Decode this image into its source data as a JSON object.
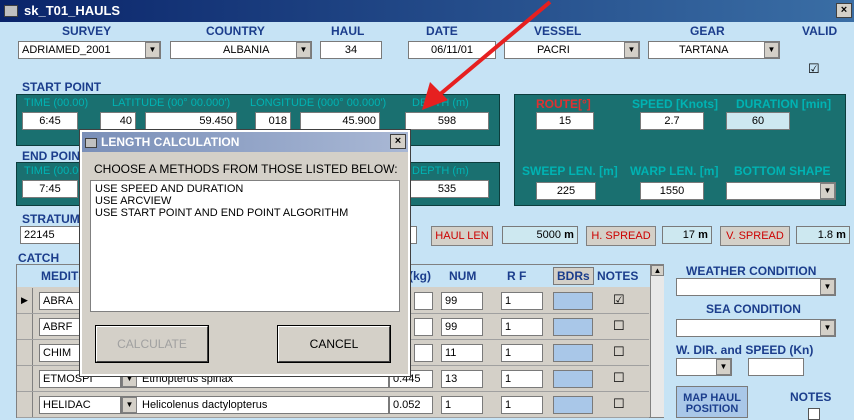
{
  "window": {
    "title": "sk_T01_HAULS",
    "close": "×"
  },
  "header": {
    "survey_label": "SURVEY",
    "survey_value": "ADRIAMED_2001",
    "country_label": "COUNTRY",
    "country_value": "ALBANIA",
    "haul_label": "HAUL",
    "haul_value": "34",
    "date_label": "DATE",
    "date_value": "06/11/01",
    "vessel_label": "VESSEL",
    "vessel_value": "PACRI",
    "gear_label": "GEAR",
    "gear_value": "TARTANA",
    "valid_label": "VALID",
    "valid_check": "☑"
  },
  "start_point": {
    "label": "START POINT",
    "time_label": "TIME (00.00)",
    "time_value": "6:45",
    "lat_label": "LATITUDE (00° 00.000')",
    "lat_deg": "40",
    "lat_min": "59.450",
    "lon_label": "LONGITUDE (000° 00.000')",
    "lon_deg": "018",
    "lon_min": "45.900",
    "depth_label": "DEPTH (m)",
    "depth_value": "598"
  },
  "end_point": {
    "label": "END POINT",
    "time_label": "TIME (00.00)",
    "time_value": "7:45",
    "depth_label": "DEPTH (m)",
    "depth_value": "535"
  },
  "right_panel": {
    "route_label": "ROUTE[°]",
    "route_value": "15",
    "speed_label": "SPEED [Knots]",
    "speed_value": "2.7",
    "duration_label": "DURATION [min]",
    "duration_value": "60",
    "sweep_label": "SWEEP LEN. [m]",
    "sweep_value": "225",
    "warp_label": "WARP LEN. [m]",
    "warp_value": "1550",
    "bottom_label": "BOTTOM SHAPE",
    "bottom_value": ""
  },
  "strata": {
    "label": "STRATUM",
    "value": "22145"
  },
  "haul_len": {
    "button": "HAUL LEN",
    "value": "5000",
    "unit": "m"
  },
  "h_spread": {
    "button": "H. SPREAD",
    "value": "17",
    "unit": "m"
  },
  "v_spread": {
    "button": "V. SPREAD",
    "value": "1.8",
    "unit": "m"
  },
  "catch": {
    "label": "CATCH",
    "col_medits": "MEDITS",
    "col_kg": "(kg)",
    "col_num": "NUM",
    "col_rf": "R F",
    "col_bdrs": "BDRs",
    "col_notes": "NOTES",
    "rows": [
      {
        "code": "ABRA",
        "name": "",
        "kg": "",
        "num": "99",
        "rf": "1",
        "notes": "☑"
      },
      {
        "code": "ABRF",
        "name": "",
        "kg": "",
        "num": "99",
        "rf": "1",
        "notes": "☐"
      },
      {
        "code": "CHIM",
        "name": "",
        "kg": "",
        "num": "11",
        "rf": "1",
        "notes": "☐"
      },
      {
        "code": "ETMOSPI",
        "name": "Etmopterus spinax",
        "kg": "0.445",
        "num": "13",
        "rf": "1",
        "notes": "☐"
      },
      {
        "code": "HELIDAC",
        "name": "Helicolenus dactylopterus",
        "kg": "0.052",
        "num": "1",
        "rf": "1",
        "notes": "☐"
      }
    ]
  },
  "conditions": {
    "weather_label": "WEATHER CONDITION",
    "sea_label": "SEA CONDITION",
    "wind_label": "W. DIR. and SPEED (Kn)",
    "map_button": "MAP HAUL POSITION",
    "notes_label": "NOTES"
  },
  "dialog": {
    "title": "LENGTH CALCULATION",
    "prompt": "CHOOSE A METHODS FROM THOSE LISTED BELOW:",
    "options": [
      "USE SPEED AND DURATION",
      "USE ARCVIEW",
      "USE START POINT AND END POINT ALGORITHM"
    ],
    "calculate": "CALCULATE",
    "cancel": "CANCEL",
    "close": "×"
  },
  "colors": {
    "arrow": "#e62020",
    "panel": "#1a7070",
    "background": "#c6e3f5"
  }
}
